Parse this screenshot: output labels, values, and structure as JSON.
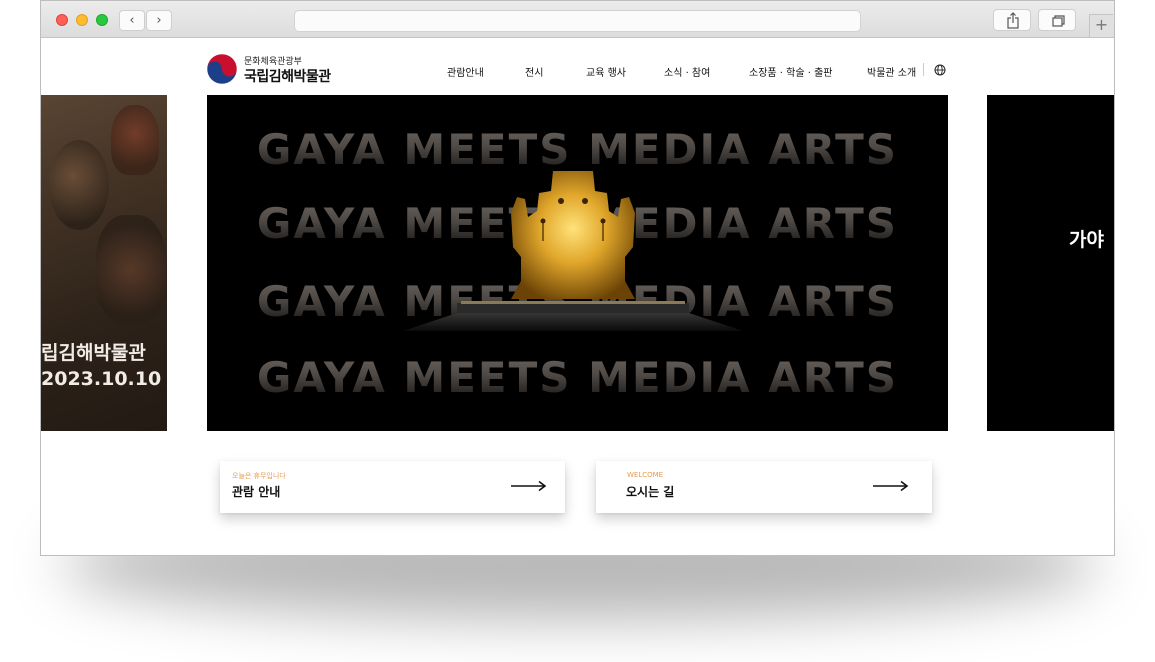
{
  "browser": {
    "back_label": "‹",
    "forward_label": "›",
    "new_tab_label": "+"
  },
  "header": {
    "ministry": "문화체육관광부",
    "museum_name": "국립김해박물관",
    "nav": [
      "관람안내",
      "전시",
      "교육 행사",
      "소식 · 참여",
      "소장품 · 학술 · 출판",
      "박물관 소개"
    ],
    "language_icon": "globe-icon"
  },
  "carousel": {
    "prev_slide": {
      "title": "립김해박물관",
      "date": "2023.10.10"
    },
    "hero_lines": [
      "GAYA MEETS MEDIA ARTS",
      "GAYA MEETS MEDIA ARTS",
      "GAYA MEETS MEDIA ARTS",
      "GAYA MEETS MEDIA ARTS"
    ],
    "next_slide": {
      "title": "가야"
    }
  },
  "quick_links": [
    {
      "subtitle": "오늘은 휴무입니다",
      "title": "관람 안내",
      "icon": "arrow-right-icon"
    },
    {
      "subtitle": "WELCOME",
      "title": "오시는 길",
      "icon": "arrow-right-icon"
    }
  ],
  "colors": {
    "accent": "#e49b52",
    "hero_bg": "#000000",
    "gold": "#e0a62a"
  }
}
